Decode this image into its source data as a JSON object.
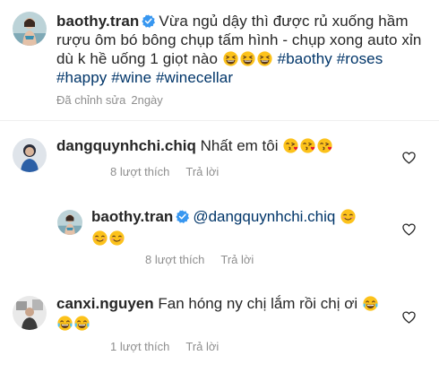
{
  "caption": {
    "username": "baothy.tran",
    "text_line1": "Vừa ngủ dậy thì được rủ xuống hầm",
    "text_line2": "rượu ôm bó bông chụp tấm hình - chụp xong auto xỉn",
    "text_line3": "dù k hề uống 1 giọt nào",
    "hashtags_line3": [
      "#baothy",
      "#roses"
    ],
    "hashtags_line4": [
      "#happy",
      "#wine",
      "#winecellar"
    ],
    "edited_label": "Đã chỉnh sửa",
    "time": "2ngày"
  },
  "comments": [
    {
      "username": "dangquynhchi.chiq",
      "text": "Nhất em tôi",
      "likes": "8 lượt thích",
      "reply_label": "Trả lời"
    },
    {
      "username": "baothy.tran",
      "mention": "@dangquynhchi.chiq",
      "likes": "8 lượt thích",
      "reply_label": "Trả lời"
    },
    {
      "username": "canxi.nguyen",
      "text": "Fan hóng ny chị lắm rồi chị ơi",
      "likes": "1 lượt thích",
      "reply_label": "Trả lời"
    }
  ],
  "colors": {
    "verified": "#3897f0",
    "hashtag": "#003569",
    "meta": "#8e8e8e",
    "divider": "#efefef",
    "emoji": "#fcc21b"
  },
  "icons": {
    "verified": "verified-badge-icon",
    "laugh": "grinning-squinting-face-icon",
    "kiss": "face-blowing-kiss-icon",
    "smile": "smiling-face-icon",
    "cry_laugh": "face-with-tears-of-joy-icon",
    "heart": "heart-outline-icon"
  }
}
